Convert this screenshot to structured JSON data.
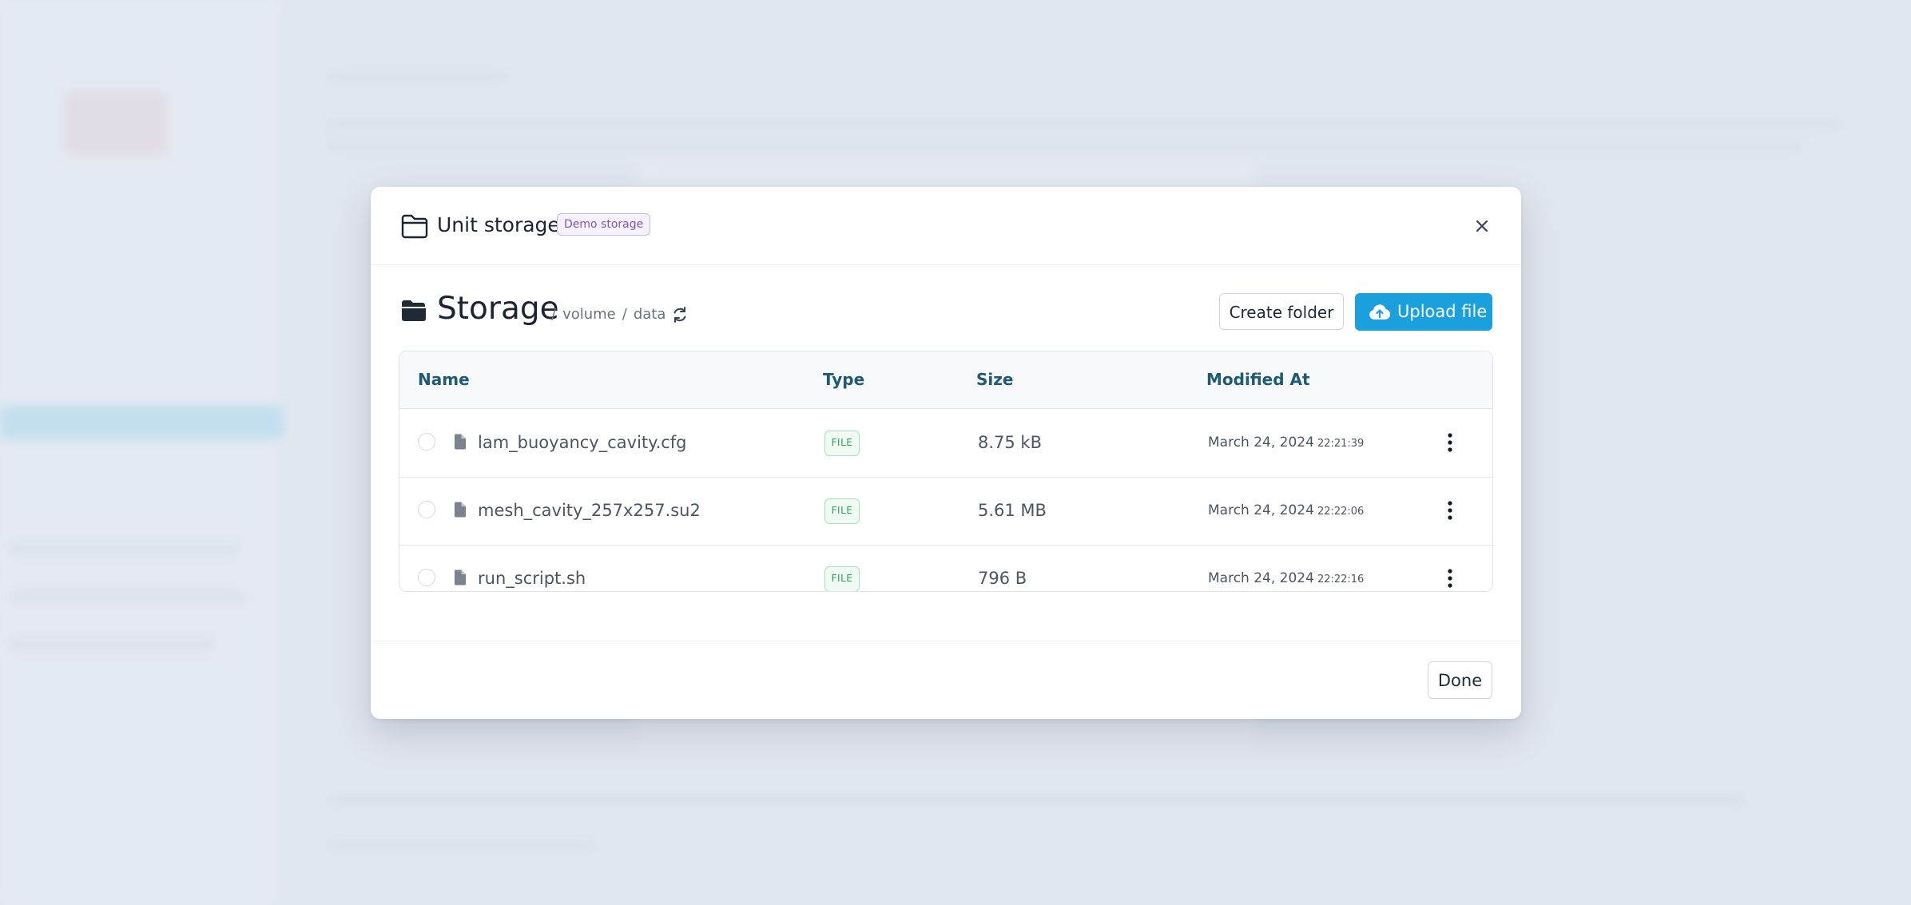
{
  "modal": {
    "title": "Unit storage",
    "badge": "Demo storage"
  },
  "storage": {
    "title": "Storage",
    "breadcrumb": [
      "/",
      "volume",
      "/",
      "data"
    ],
    "create_folder_label": "Create folder",
    "upload_label": "Upload file"
  },
  "table": {
    "columns": [
      "Name",
      "Type",
      "Size",
      "Modified At"
    ],
    "rows": [
      {
        "name": "lam_buoyancy_cavity.cfg",
        "type": "FILE",
        "size": "8.75 kB",
        "date": "March 24, 2024",
        "time": "22:21:39"
      },
      {
        "name": "mesh_cavity_257x257.su2",
        "type": "FILE",
        "size": "5.61 MB",
        "date": "March 24, 2024",
        "time": "22:22:06"
      },
      {
        "name": "run_script.sh",
        "type": "FILE",
        "size": "796 B",
        "date": "March 24, 2024",
        "time": "22:22:16"
      }
    ]
  },
  "footer": {
    "done_label": "Done"
  },
  "colors": {
    "accent": "#1ba0de",
    "header_text": "#1d5a73",
    "file_badge": "#2aa05a",
    "demo_badge": "#7b58c7"
  },
  "icons": [
    "folder-open-icon",
    "close-icon",
    "folder-filled-icon",
    "refresh-icon",
    "cloud-upload-icon",
    "document-icon",
    "kebab-menu-icon"
  ]
}
